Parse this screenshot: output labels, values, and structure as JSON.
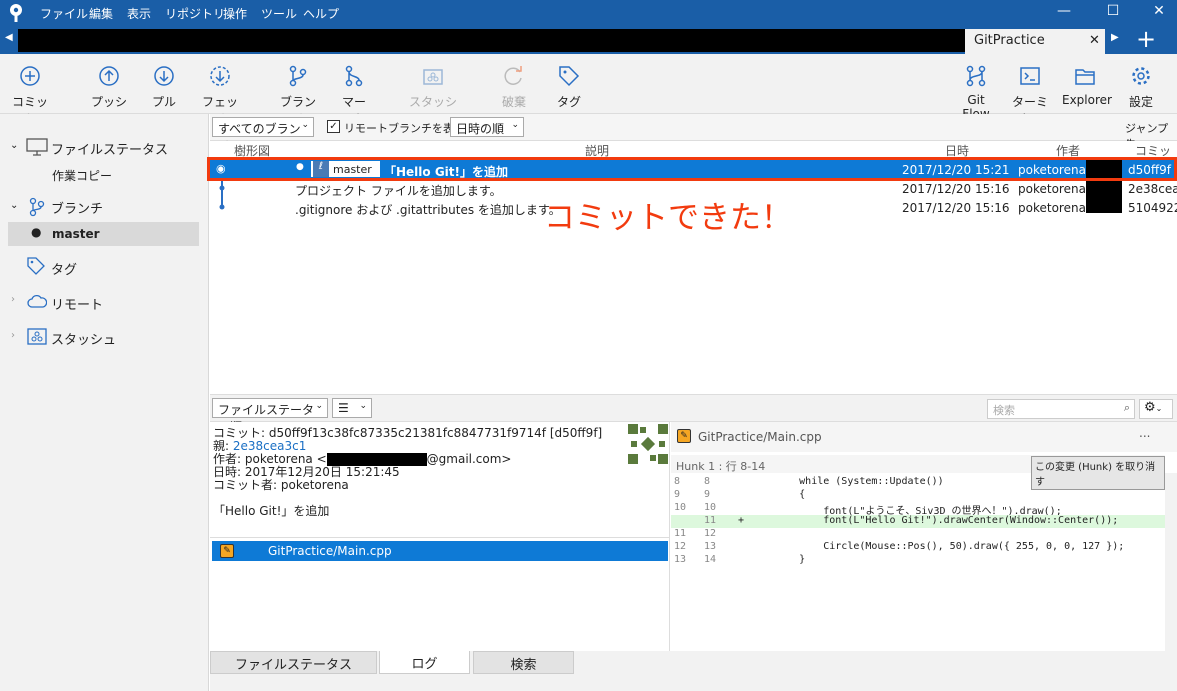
{
  "titlebar": {
    "menus": [
      "ファイル",
      "編集",
      "表示",
      "リポジトリ",
      "操作",
      "ツール",
      "ヘルプ"
    ],
    "min": "—",
    "max": "☐",
    "close": "✕"
  },
  "tabs": {
    "active": "GitPractice",
    "close": "✕",
    "add": "+"
  },
  "toolbar": {
    "commit": "コミット",
    "push": "プッシュ",
    "pull": "プル",
    "fetch": "フェッチ",
    "branch": "ブランチ",
    "merge": "マージ",
    "stash": "スタッシュ",
    "discard": "破棄",
    "tag": "タグ",
    "gitflow": "Git Flow",
    "terminal": "ターミナル",
    "explorer": "Explorer",
    "settings": "設定"
  },
  "sidebar": {
    "file_status": "ファイルステータス",
    "working_copy": "作業コピー",
    "branches": "ブランチ",
    "master": "master",
    "tags": "タグ",
    "remotes": "リモート",
    "stashes": "スタッシュ"
  },
  "filter": {
    "branches": "すべてのブランチ",
    "show_remote": "リモートブランチを表示",
    "order": "日時の順",
    "jump": "ジャンプ先:"
  },
  "columns": {
    "graph": "樹形図",
    "description": "説明",
    "date": "日時",
    "author": "作者",
    "commit": "コミット"
  },
  "commits": [
    {
      "branch": "master",
      "message": "「Hello Git!」を追加",
      "date": "2017/12/20  15:21",
      "author": "poketorena <",
      "hash": "d50ff9f"
    },
    {
      "message": "プロジェクト ファイルを追加します。",
      "date": "2017/12/20  15:16",
      "author": "poketorena <",
      "hash": "2e38cea"
    },
    {
      "message": ".gitignore および .gitattributes を追加します。",
      "date": "2017/12/20  15:16",
      "author": "poketorena <",
      "hash": "5104922"
    }
  ],
  "annotation": "コミットできた！",
  "lower": {
    "order": "ファイルステータス順",
    "search_placeholder": "検索"
  },
  "detail": {
    "commit": "コミット: d50ff9f13c38fc87335c21381fc8847731f9714f [d50ff9f]",
    "parent_label": "親: ",
    "parent": "2e38cea3c1",
    "author_prefix": "作者: poketorena <",
    "author_suffix": "@gmail.com>",
    "date": "日時: 2017年12月20日 15:21:45",
    "committer": "コミット者: poketorena",
    "message": "「Hello Git!」を追加"
  },
  "file": "GitPractice/Main.cpp",
  "diff": {
    "file": "GitPractice/Main.cpp",
    "hunk": "Hunk 1 : 行 8-14",
    "discard_hunk": "この変更 (Hunk) を取り消す",
    "more": "...",
    "lines": [
      {
        "o": "8",
        "n": "8",
        "m": "",
        "c": "        while (System::Update())"
      },
      {
        "o": "9",
        "n": "9",
        "m": "",
        "c": "        {"
      },
      {
        "o": "10",
        "n": "10",
        "m": "",
        "c": "            font(L\"ようこそ、Siv3D の世界へ！\").draw();"
      },
      {
        "o": "",
        "n": "11",
        "m": "+",
        "c": "            font(L\"Hello Git!\").drawCenter(Window::Center());"
      },
      {
        "o": "11",
        "n": "12",
        "m": "",
        "c": ""
      },
      {
        "o": "12",
        "n": "13",
        "m": "",
        "c": "            Circle(Mouse::Pos(), 50).draw({ 255, 0, 0, 127 });"
      },
      {
        "o": "13",
        "n": "14",
        "m": "",
        "c": "        }"
      }
    ]
  },
  "bottom_tabs": [
    "ファイルステータス",
    "ログ",
    "検索"
  ],
  "colors": {
    "accent": "#1a5ea7",
    "selection": "#0e7ad6",
    "highlight": "#f23b0f"
  }
}
